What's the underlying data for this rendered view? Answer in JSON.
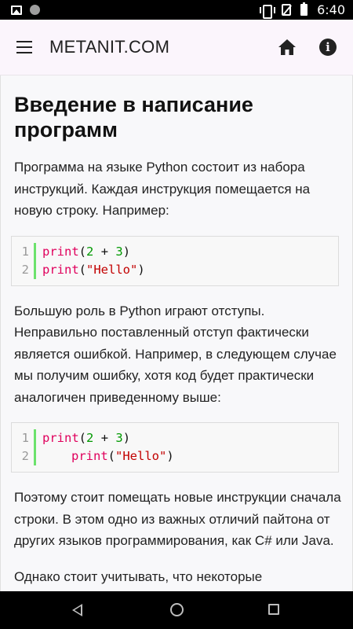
{
  "status": {
    "time": "6:40"
  },
  "appbar": {
    "title": "METANIT.COM"
  },
  "article": {
    "title": "Введение в написание программ",
    "p1": "Программа на языке Python состоит из набора инструкций. Каждая инструкция помещается на новую строку. Например:",
    "code1": [
      {
        "line": "1",
        "fn": "print",
        "open": "(",
        "a": "2",
        "op": " + ",
        "b": "3",
        "close": ")"
      },
      {
        "line": "2",
        "fn": "print",
        "open": "(",
        "str": "\"Hello\"",
        "close": ")"
      }
    ],
    "p2": "Большую роль в Python играют отступы. Неправильно поставленный отступ фактически является ошибкой. Например, в следующем случае мы получим ошибку, хотя код будет практически аналогичен приведенному выше:",
    "code2": [
      {
        "line": "1",
        "fn": "print",
        "open": "(",
        "a": "2",
        "op": " + ",
        "b": "3",
        "close": ")"
      },
      {
        "line": "2",
        "fn": "print",
        "open": "(",
        "str": "\"Hello\"",
        "close": ")"
      }
    ],
    "p3": "Поэтому стоит помещать новые инструкции сначала строки. В этом одно из важных отличий пайтона от других языков программирования, как C# или Java.",
    "p4": "Однако стоит учитывать, что некоторые"
  },
  "icons": {
    "menu": "menu-icon",
    "home": "home-icon",
    "info": "info-icon"
  },
  "colors": {
    "appbar_bg": "#fbf5fc",
    "content_bg": "#f8f8fa",
    "code_keyword": "#e0005c",
    "code_number": "#009900",
    "code_string": "#c20000",
    "code_gutter_bar": "#6ce26c"
  }
}
